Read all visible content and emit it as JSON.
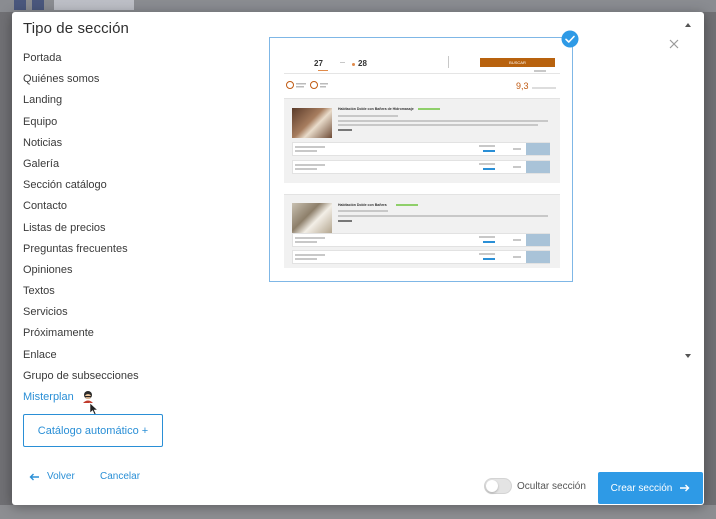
{
  "modal": {
    "title": "Tipo de sección"
  },
  "section_types": [
    "Portada",
    "Quiénes somos",
    "Landing",
    "Equipo",
    "Noticias",
    "Galería",
    "Sección catálogo",
    "Contacto",
    "Listas de precios",
    "Preguntas frecuentes",
    "Opiniones",
    "Textos",
    "Servicios",
    "Próximamente",
    "Enlace",
    "Grupo de subsecciones",
    "Misterplan"
  ],
  "selected_type": "Misterplan",
  "buttons": {
    "auto_catalog": "Catálogo automático +",
    "back": "Volver",
    "cancel": "Cancelar",
    "create": "Crear sección"
  },
  "toggle": {
    "label": "Ocultar sección",
    "on": false
  },
  "preview": {
    "date_start": "27",
    "date_end": "28",
    "search_button": "BUSCAR",
    "score": "9,3",
    "rooms": [
      "Habitación Doble con Bañera de Hidromasaje",
      "Habitación Doble con Bañera"
    ]
  },
  "colors": {
    "accent": "#2a8fd6",
    "primary_button": "#2e9ae6",
    "preview_orange": "#b8620e",
    "score": "#c05a12"
  },
  "icons": {
    "close": "close-icon",
    "back": "arrow-left-icon",
    "create": "arrow-right-icon",
    "check": "check-circle-icon",
    "avatar": "avatar-icon",
    "scroll_up": "chevron-up-icon",
    "scroll_down": "chevron-down-icon"
  }
}
